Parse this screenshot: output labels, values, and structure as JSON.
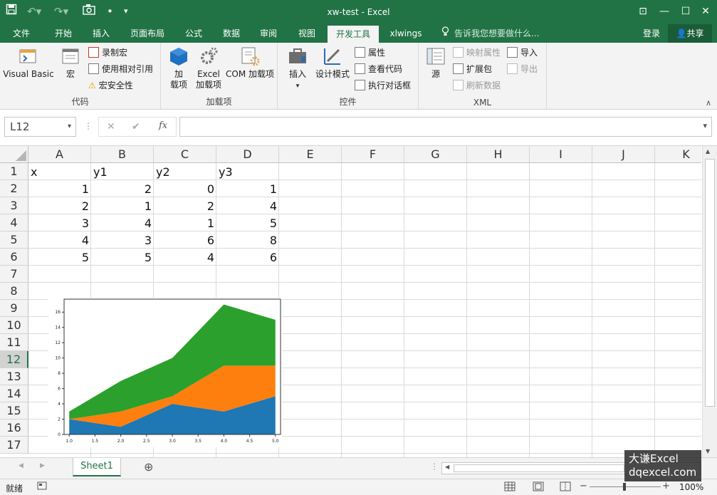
{
  "window": {
    "title": "xw-test - Excel"
  },
  "quick_access": {
    "save_icon": "save-icon",
    "undo_icon": "undo-icon",
    "redo_icon": "redo-icon",
    "camera_icon": "camera-icon",
    "bullet": "•",
    "customize": "▾"
  },
  "window_controls": {
    "restore_ribbon": "⊡",
    "minimize": "—",
    "maximize": "☐",
    "close": "✕"
  },
  "tabs": [
    {
      "label": "文件"
    },
    {
      "label": "开始"
    },
    {
      "label": "插入"
    },
    {
      "label": "页面布局"
    },
    {
      "label": "公式"
    },
    {
      "label": "数据"
    },
    {
      "label": "审阅"
    },
    {
      "label": "视图"
    },
    {
      "label": "开发工具"
    },
    {
      "label": "xlwings"
    }
  ],
  "tell_me": "告诉我您想要做什么...",
  "login": "登录",
  "share": "共享",
  "ribbon": {
    "code": {
      "label": "代码",
      "visual_basic": "Visual Basic",
      "macros": "宏",
      "record_macro": "录制宏",
      "relative_ref": "使用相对引用",
      "macro_security": "宏安全性"
    },
    "addins": {
      "label": "加载项",
      "addins_line1": "加",
      "addins_line2": "载项",
      "excel_addins_line1": "Excel",
      "excel_addins_line2": "加载项",
      "com_addins": "COM 加载项"
    },
    "controls": {
      "label": "控件",
      "insert": "插入",
      "insert_arrow": "▾",
      "design_mode": "设计模式",
      "properties": "属性",
      "view_code": "查看代码",
      "run_dialog": "执行对话框"
    },
    "xml": {
      "label": "XML",
      "source": "源",
      "map_properties": "映射属性",
      "expansion_packs": "扩展包",
      "refresh_data": "刷新数据",
      "import": "导入",
      "export": "导出"
    },
    "collapse": "∧"
  },
  "formula_bar": {
    "name_box": "L12",
    "name_arrow": "▾",
    "menu_dots": "⋮",
    "cancel": "✕",
    "enter": "✔",
    "fx": "fx",
    "value": "",
    "expand": "▾"
  },
  "columns": [
    "A",
    "B",
    "C",
    "D",
    "E",
    "F",
    "G",
    "H",
    "I",
    "J",
    "K"
  ],
  "rows": [
    "1",
    "2",
    "3",
    "4",
    "5",
    "6",
    "7",
    "8",
    "9",
    "10",
    "11",
    "12",
    "13",
    "14",
    "15",
    "16",
    "17"
  ],
  "selected_row": "12",
  "cells": [
    [
      "x",
      "y1",
      "y2",
      "y3"
    ],
    [
      "1",
      "2",
      "0",
      "1"
    ],
    [
      "2",
      "1",
      "2",
      "4"
    ],
    [
      "3",
      "4",
      "1",
      "5"
    ],
    [
      "4",
      "3",
      "6",
      "8"
    ],
    [
      "5",
      "5",
      "4",
      "6"
    ]
  ],
  "chart_data": {
    "type": "area",
    "stacked": true,
    "x": [
      1,
      2,
      3,
      4,
      5
    ],
    "series": [
      {
        "values": [
          2,
          1,
          4,
          3,
          5
        ],
        "color": "#1f77b4"
      },
      {
        "values": [
          0,
          2,
          1,
          6,
          4
        ],
        "color": "#ff7f0e"
      },
      {
        "values": [
          1,
          4,
          5,
          8,
          6
        ],
        "color": "#2ca02c"
      }
    ],
    "x_ticks": [
      "1.0",
      "1.5",
      "2.0",
      "2.5",
      "3.0",
      "3.5",
      "4.0",
      "4.5",
      "5.0"
    ],
    "y_ticks": [
      "0",
      "2",
      "4",
      "6",
      "8",
      "10",
      "12",
      "14",
      "16"
    ],
    "xlim": [
      0.9,
      5.1
    ],
    "ylim": [
      0,
      17.7
    ],
    "grid": false
  },
  "sheets": [
    {
      "name": "Sheet1"
    }
  ],
  "add_sheet": "⊕",
  "status": {
    "ready": "就绪",
    "zoom": "100%",
    "zoom_minus": "−",
    "zoom_plus": "+"
  },
  "watermark": {
    "line1": "大谦Excel",
    "line2": "dqexcel.com"
  }
}
